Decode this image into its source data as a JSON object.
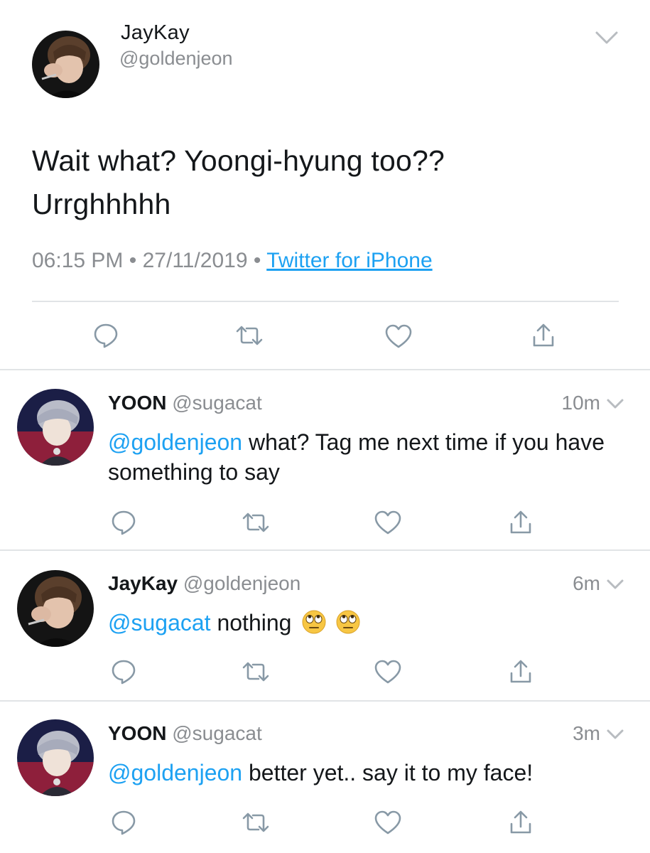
{
  "main_tweet": {
    "name": "JayKay",
    "handle": "@goldenjeon",
    "text_line1": "Wait what? Yoongi-hyung too??",
    "text_line2": "Urrghhhhh",
    "time": "06:15 PM",
    "date": "27/11/2019",
    "separator": "•",
    "source": "Twitter for iPhone"
  },
  "replies": [
    {
      "name": "YOON",
      "handle": "@sugacat",
      "time": "10m",
      "mention": "@goldenjeon",
      "text": " what? Tag me next time if you have something to say"
    },
    {
      "name": "JayKay",
      "handle": "@goldenjeon",
      "time": "6m",
      "mention": "@sugacat",
      "text": " nothing",
      "emojis": [
        "face-with-rolling-eyes-emoji",
        "face-with-rolling-eyes-emoji"
      ]
    },
    {
      "name": "YOON",
      "handle": "@sugacat",
      "time": "3m",
      "mention": "@goldenjeon",
      "text": " better yet.. say it to my face!"
    }
  ],
  "colors": {
    "link": "#1da1f2",
    "secondary_text": "#8a8d91",
    "icon": "#8899a6",
    "divider": "#e1e4e6"
  },
  "icons": [
    "reply-icon",
    "retweet-icon",
    "like-icon",
    "share-icon",
    "chevron-down-icon"
  ]
}
